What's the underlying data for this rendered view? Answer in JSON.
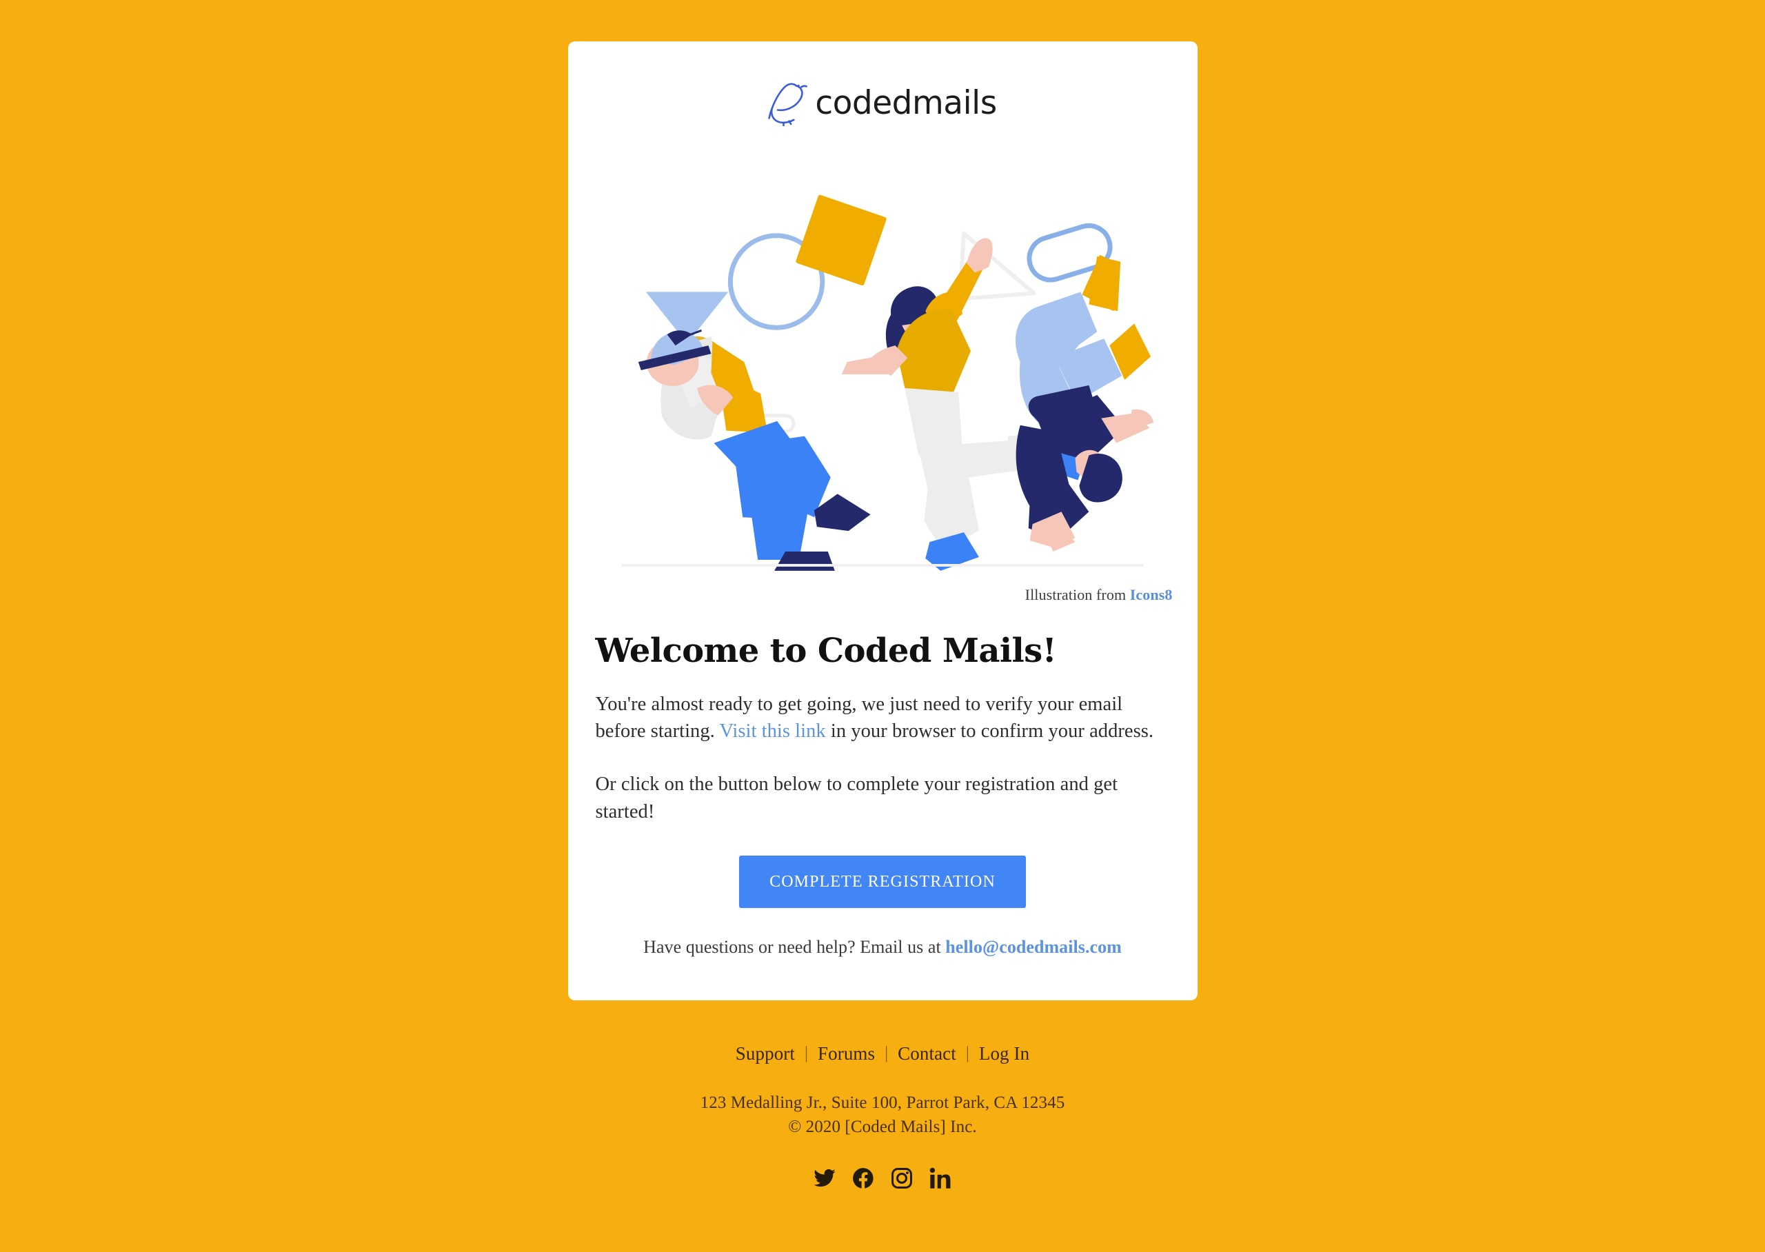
{
  "brand": {
    "logo_word": "codedmails",
    "logo_icon": "bird-icon",
    "logo_color": "#3b5bdb"
  },
  "colors": {
    "background": "#f7ae11",
    "card": "#ffffff",
    "accent_blue": "#4285f4",
    "link_blue": "#5b93e0",
    "footer_text": "#3a2605",
    "illustration_yellow": "#f0ad00",
    "illustration_navy": "#23296b",
    "illustration_blue": "#3b82f6",
    "illustration_light_blue": "#a7c4f0",
    "illustration_gray": "#e8e8e8",
    "illustration_skin": "#f6c6b8"
  },
  "credit": {
    "prefix": "Illustration from ",
    "link_label": "Icons8"
  },
  "content": {
    "title": "Welcome to Coded Mails!",
    "paragraph1_part1": "You're almost ready to get going, we just need to verify your email before starting. ",
    "paragraph1_link": "Visit this link",
    "paragraph1_part2": " in your browser to confirm your address.",
    "paragraph2": "Or click on the button below to complete your registration and get started!"
  },
  "cta": {
    "label": "COMPLETE REGISTRATION"
  },
  "help": {
    "prefix": "Have questions or need help? Email us at ",
    "email": "hello@codedmails.com"
  },
  "footer": {
    "links": [
      {
        "label": "Support"
      },
      {
        "label": "Forums"
      },
      {
        "label": "Contact"
      },
      {
        "label": "Log In"
      }
    ],
    "separator": "|",
    "address": "123 Medalling Jr., Suite 100, Parrot Park, CA 12345",
    "copyright": "© 2020 [Coded Mails] Inc.",
    "social": [
      {
        "name": "twitter-icon"
      },
      {
        "name": "facebook-icon"
      },
      {
        "name": "instagram-icon"
      },
      {
        "name": "linkedin-icon"
      }
    ]
  }
}
